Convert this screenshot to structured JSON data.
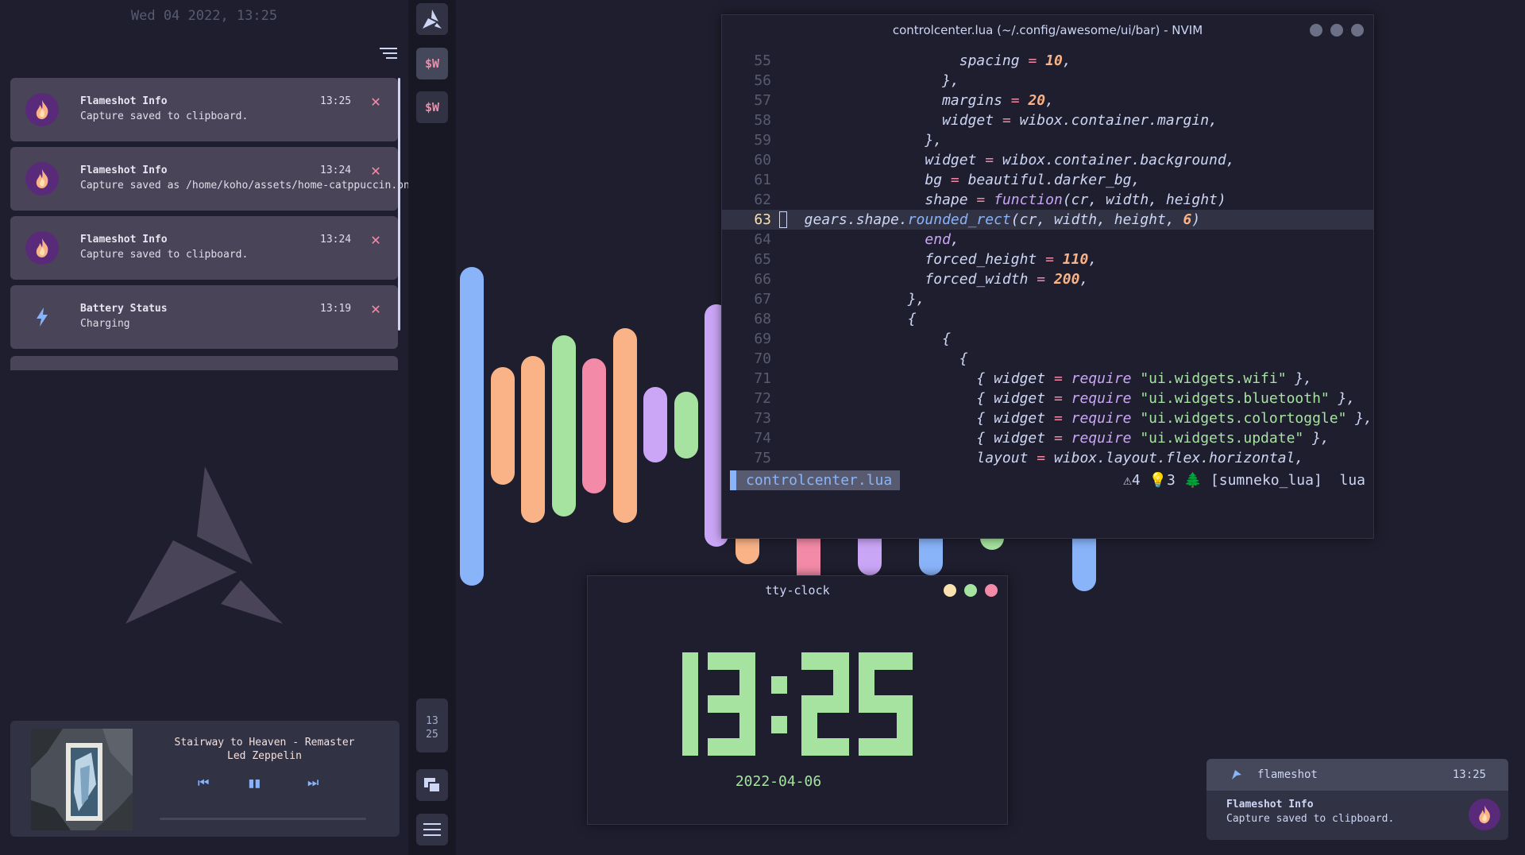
{
  "notification_center": {
    "date": "Wed 04 2022, 13:25",
    "notifications": [
      {
        "app": "Flameshot Info",
        "body": "Capture saved to clipboard.",
        "time": "13:25",
        "icon": "flameshot-icon"
      },
      {
        "app": "Flameshot Info",
        "body": "Capture saved as /home/koho/assets/home-catppuccin.png",
        "time": "13:24",
        "icon": "flameshot-icon"
      },
      {
        "app": "Flameshot Info",
        "body": "Capture saved to clipboard.",
        "time": "13:24",
        "icon": "flameshot-icon"
      },
      {
        "app": "Battery Status",
        "body": "Charging",
        "time": "13:19",
        "icon": "lightning-icon"
      }
    ],
    "close_glyph": "✕"
  },
  "music_player": {
    "title": "Stairway to Heaven - Remaster",
    "artist": "Led Zeppelin",
    "prev_glyph": "⏮",
    "play_glyph": "▮▮",
    "next_glyph": "⏭"
  },
  "vertical_bar": {
    "workspace_1": "$W",
    "workspace_2": "$W",
    "clock_hour": "13",
    "clock_minute": "25"
  },
  "nvim": {
    "title": "controlcenter.lua (~/.config/awesome/ui/bar) - NVIM",
    "current_line": "63",
    "statusline": {
      "filename": "controlcenter.lua",
      "diagnostics": "⚠4 💡3 🌲 [sumneko_lua]  lua"
    }
  },
  "tty_clock": {
    "title": "tty-clock",
    "time": "13:25",
    "date": "2022-04-06"
  },
  "popup": {
    "app": "flameshot",
    "time": "13:25",
    "title": "Flameshot Info",
    "body": "Capture saved to clipboard."
  },
  "colors": {
    "base": "#1e1e2e",
    "mantle": "#181825",
    "surface": "#313244",
    "card": "#4a4458",
    "blue": "#89b4fa",
    "peach": "#fab387",
    "green": "#a6e3a1",
    "pink": "#f38ba8",
    "mauve": "#cba6f7",
    "yellow": "#f9e2af"
  }
}
